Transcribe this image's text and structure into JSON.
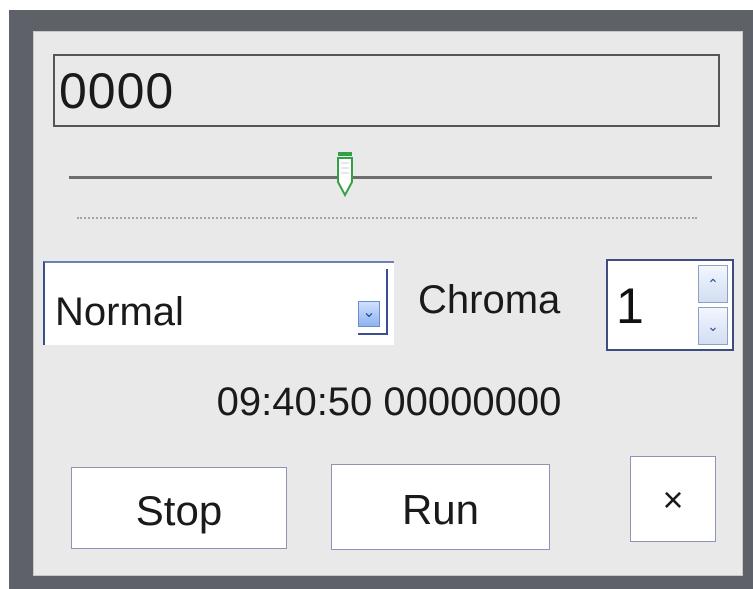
{
  "counter": {
    "value": "0000"
  },
  "slider": {
    "position_fraction": 0.43
  },
  "mode_select": {
    "selected": "Normal"
  },
  "chroma": {
    "label": "Chroma",
    "value": "1"
  },
  "status": {
    "timestamp": "09:40:50 00000000"
  },
  "buttons": {
    "stop": "Stop",
    "run": "Run",
    "close": "×"
  },
  "icons": {
    "dropdown": "chevron-down-icon",
    "spin_up": "chevron-up-icon",
    "spin_down": "chevron-down-icon",
    "close": "close-icon",
    "slider_thumb": "slider-thumb-icon"
  },
  "colors": {
    "frame": "#5e6167",
    "panel": "#e9e9ea",
    "thumb_stroke": "#33a045",
    "accent": "#3b4f90"
  }
}
